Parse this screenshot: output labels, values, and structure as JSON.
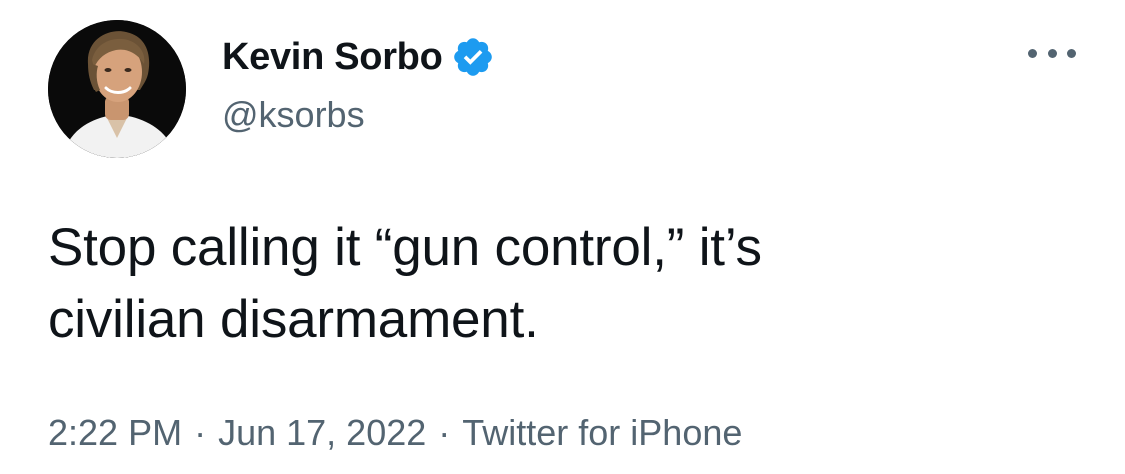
{
  "author": {
    "display_name": "Kevin Sorbo",
    "handle": "@ksorbs",
    "verified": true,
    "avatar_icon": "profile-photo"
  },
  "tweet": {
    "text_line_1": "Stop calling it “gun control,” it’s",
    "text_line_2": "civilian disarmament."
  },
  "meta": {
    "time": "2:22 PM",
    "date": "Jun 17, 2022",
    "source": "Twitter for iPhone",
    "separator": "·"
  },
  "icons": {
    "more": "more-horizontal-icon",
    "verified": "verified-badge-icon"
  },
  "colors": {
    "text_primary": "#0f1419",
    "text_secondary": "#536471",
    "verified_blue": "#1d9bf0",
    "background": "#ffffff"
  }
}
